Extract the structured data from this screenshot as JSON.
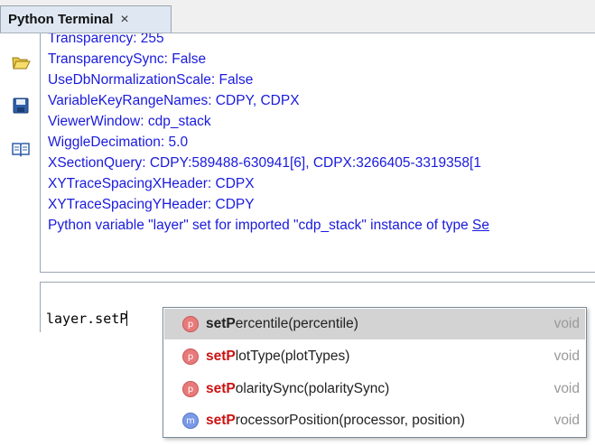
{
  "tab": {
    "title": "Python Terminal",
    "close_glyph": "×"
  },
  "toolbar": {
    "icons": [
      "folder-open-icon",
      "save-icon",
      "book-icon"
    ]
  },
  "output": {
    "lines": [
      "Transparency: 255",
      "TransparencySync: False",
      "UseDbNormalizationScale: False",
      "VariableKeyRangeNames: CDPY, CDPX",
      "ViewerWindow: cdp_stack",
      "WiggleDecimation: 5.0",
      "XSectionQuery: CDPY:589488-630941[6], CDPX:3266405-3319358[1",
      "XYTraceSpacingXHeader: CDPX",
      "XYTraceSpacingYHeader: CDPY"
    ],
    "last_line_prefix": "Python variable \"layer\" set for imported \"cdp_stack\" instance of type ",
    "last_line_link": "Se",
    "text_color": "#1a1add"
  },
  "input": {
    "value": "layer.setP"
  },
  "completions": [
    {
      "kind": "p",
      "match": "setP",
      "rest": "ercentile(percentile)",
      "return": "void",
      "selected": true
    },
    {
      "kind": "p",
      "match": "setP",
      "rest": "lotType(plotTypes)",
      "return": "void",
      "selected": false
    },
    {
      "kind": "p",
      "match": "setP",
      "rest": "olaritySync(polaritySync)",
      "return": "void",
      "selected": false
    },
    {
      "kind": "m",
      "match": "setP",
      "rest": "rocessorPosition(processor, position)",
      "return": "void",
      "selected": false
    }
  ]
}
